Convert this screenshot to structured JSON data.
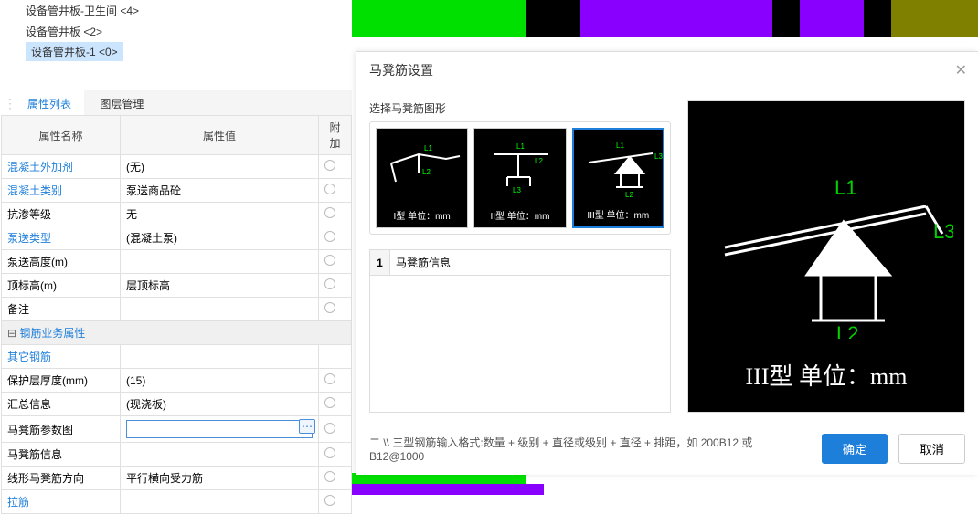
{
  "tree": {
    "items": [
      "设备管井板-卫生间 <4>",
      "设备管井板 <2>",
      "设备管井板-1 <0>"
    ]
  },
  "tabs": {
    "props": "属性列表",
    "layers": "图层管理"
  },
  "headers": {
    "name": "属性名称",
    "value": "属性值",
    "extra": "附加"
  },
  "rows": {
    "r1n": "混凝土外加剂",
    "r1v": "(无)",
    "r2n": "混凝土类别",
    "r2v": "泵送商品砼",
    "r3n": "抗渗等级",
    "r3v": "无",
    "r4n": "泵送类型",
    "r4v": "(混凝土泵)",
    "r5n": "泵送高度(m)",
    "r5v": "",
    "r6n": "顶标高(m)",
    "r6v": "层顶标高",
    "r7n": "备注",
    "r7v": "",
    "grp": "钢筋业务属性",
    "r8n": "其它钢筋",
    "r9n": "保护层厚度(mm)",
    "r9v": "(15)",
    "r10n": "汇总信息",
    "r10v": "(现浇板)",
    "r11n": "马凳筋参数图",
    "r11v": "",
    "r12n": "马凳筋信息",
    "r13n": "线形马凳筋方向",
    "r13v": "平行横向受力筋",
    "r14n": "拉筋"
  },
  "dialog": {
    "title": "马凳筋设置",
    "section": "选择马凳筋图形",
    "thumbs": [
      {
        "label": "I型  单位：mm"
      },
      {
        "label": "II型  单位：mm"
      },
      {
        "label": "III型  单位：mm"
      }
    ],
    "infohdr": "马凳筋信息",
    "rownum": "1",
    "preview_caption": "III型  单位：mm",
    "L1": "L1",
    "L2": "L2",
    "L3": "L3",
    "hint": "二 \\\\ 三型钢筋输入格式:数量 + 级别 + 直径或级别 + 直径 + 排距，如 200B12 或 B12@1000",
    "ok": "确定",
    "cancel": "取消"
  }
}
